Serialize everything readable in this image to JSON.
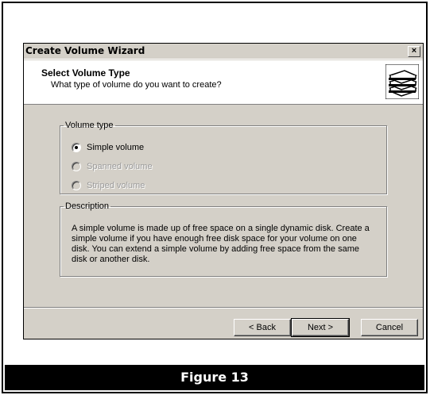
{
  "window": {
    "title": "Create Volume Wizard",
    "close_label": "×"
  },
  "header": {
    "title": "Select Volume Type",
    "subtitle": "What type of volume do you want to create?",
    "icon": "disk-stack-icon"
  },
  "volume_type": {
    "legend": "Volume type",
    "options": [
      {
        "label": "Simple volume",
        "selected": true,
        "enabled": true
      },
      {
        "label": "Spanned volume",
        "selected": false,
        "enabled": false
      },
      {
        "label": "Striped volume",
        "selected": false,
        "enabled": false
      }
    ]
  },
  "description": {
    "legend": "Description",
    "text": "A simple volume is made up of free space on a single dynamic disk. Create a simple volume if you have enough free disk space for your volume on one disk. You can extend a simple volume by adding free space from the same disk or another disk."
  },
  "buttons": {
    "back": "< Back",
    "next": "Next >",
    "cancel": "Cancel"
  },
  "caption": "Figure 13",
  "colors": {
    "dialog_bg": "#d4d0c8",
    "caption_bg": "#000000"
  }
}
